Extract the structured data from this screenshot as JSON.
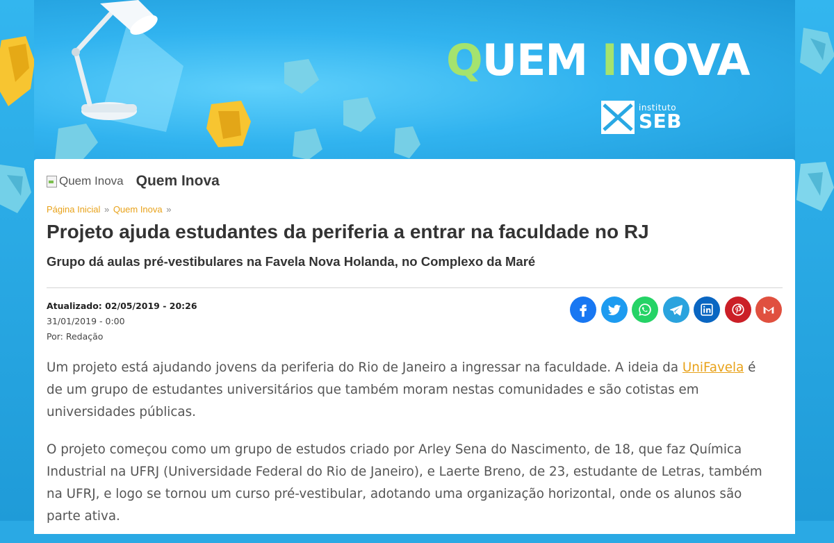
{
  "banner": {
    "brand_q": "Q",
    "brand_uem": "UEM ",
    "brand_i": "I",
    "brand_nova": "NOVA",
    "seb_small": "instituto",
    "seb_big": "SEB"
  },
  "category": {
    "image_alt": "Quem Inova",
    "title": "Quem Inova"
  },
  "breadcrumb": {
    "items": [
      "Página Inicial",
      "Quem Inova"
    ],
    "separator": "»"
  },
  "article": {
    "headline": "Projeto ajuda estudantes da periferia a entrar na faculdade no RJ",
    "subheadline": "Grupo dá aulas pré-vestibulares na Favela Nova Holanda, no Complexo da Maré",
    "updated": "Atualizado: 02/05/2019 - 20:26",
    "published": "31/01/2019 - 0:00",
    "author": "Por: Redação",
    "p1_before": "Um projeto está ajudando jovens da periferia do Rio de Janeiro a ingressar na faculdade. A ideia da ",
    "p1_link": "UniFavela",
    "p1_after": " é de um grupo de estudantes universitários que também moram nestas comunidades e são cotistas em universidades públicas.",
    "p2": "O projeto começou como um grupo de estudos criado por Arley Sena do Nascimento, de 18, que faz Química Industrial na UFRJ (Universidade Federal do Rio de Janeiro), e Laerte Breno, de 23, estudante de Letras, também na UFRJ, e logo se tornou um curso pré-vestibular, adotando uma organização horizontal, onde os alunos são parte ativa."
  },
  "share": [
    {
      "icon": "facebook-icon",
      "color": "#1877f2"
    },
    {
      "icon": "twitter-icon",
      "color": "#1d9bf0"
    },
    {
      "icon": "whatsapp-icon",
      "color": "#25d366"
    },
    {
      "icon": "telegram-icon",
      "color": "#2aa3de"
    },
    {
      "icon": "linkedin-icon",
      "color": "#0a66c2"
    },
    {
      "icon": "pinterest-icon",
      "color": "#cb1f27"
    },
    {
      "icon": "gmail-icon",
      "color": "#e0503f"
    }
  ]
}
